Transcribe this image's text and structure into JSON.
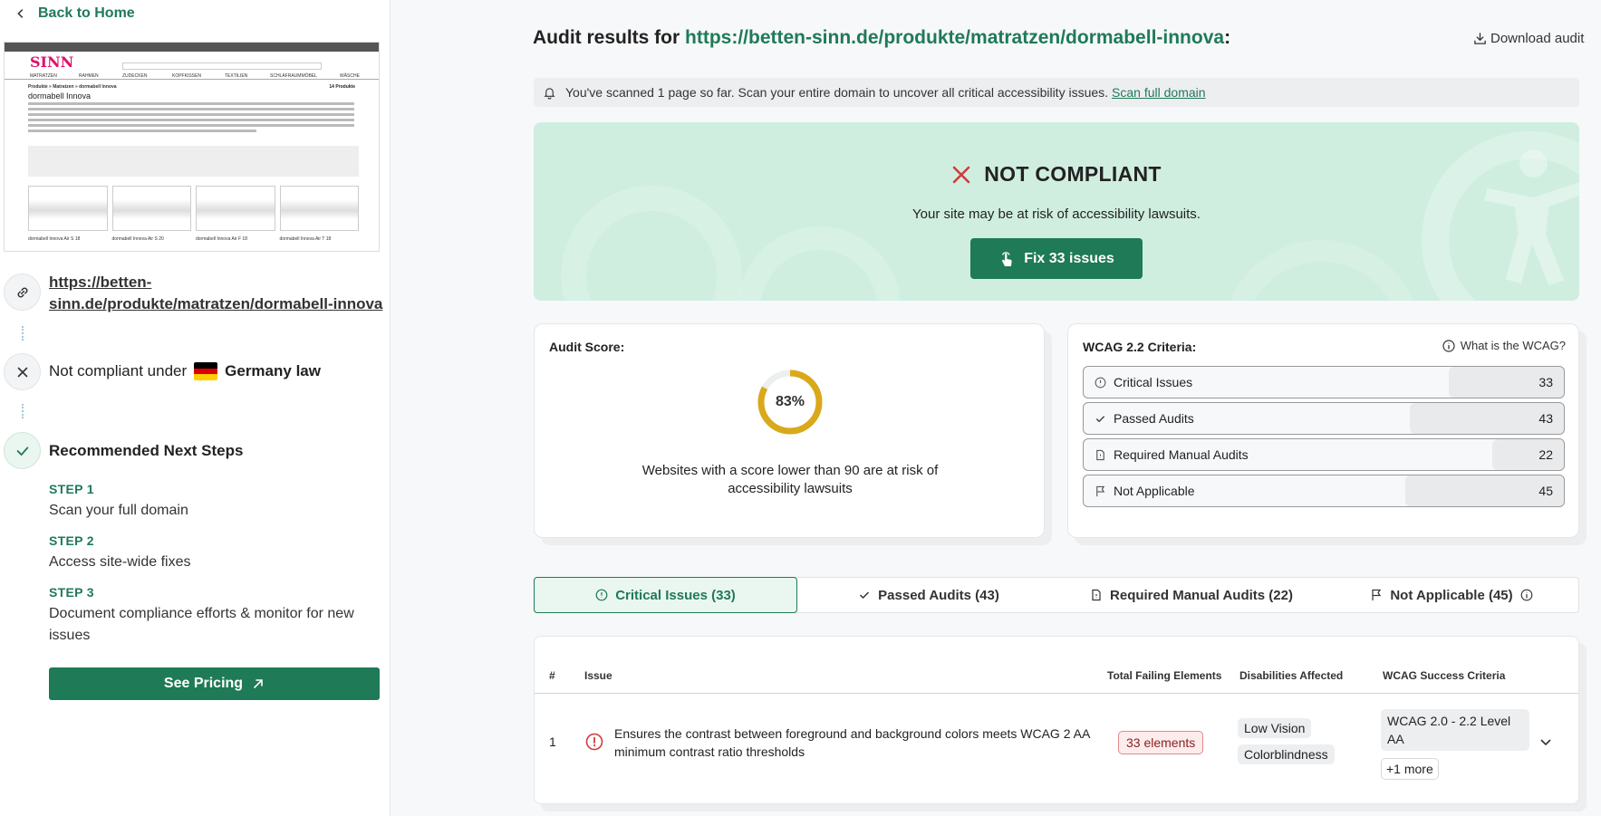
{
  "sidebar": {
    "back_label": "Back to Home",
    "preview": {
      "brand": "SINN",
      "breadcrumb": "Produkte » Matratzen » dormabell Innova",
      "count": "14 Produkte",
      "title": "dormabell Innova",
      "nav": [
        "MATRATZEN",
        "RAHMEN",
        "ZUDECKEN",
        "KOPFKISSEN",
        "TEXTILIEN",
        "SCHLAFRAUMMÖBEL",
        "WÄSCHE"
      ],
      "products": [
        "dormabell Innova Air S 18",
        "dormabell Innova Air S 20",
        "dormabell Innova Air F 18",
        "dormabell Innova Air T 18"
      ]
    },
    "url": "https://betten-sinn.de/produkte/matratzen/dormabell-innova",
    "noncompliant_prefix": "Not compliant under",
    "law": "Germany law",
    "recommended_title": "Recommended Next Steps",
    "steps": [
      {
        "label": "STEP 1",
        "text": "Scan your full domain"
      },
      {
        "label": "STEP 2",
        "text": "Access site-wide fixes"
      },
      {
        "label": "STEP 3",
        "text": "Document compliance efforts & monitor for new issues"
      }
    ],
    "pricing_label": "See Pricing"
  },
  "header": {
    "title_prefix": "Audit results for",
    "url": "https://betten-sinn.de/produkte/matratzen/dormabell-innova",
    "title_suffix": ":",
    "download_label": "Download audit"
  },
  "banner": {
    "text": "You've scanned 1 page so far. Scan your entire domain to uncover all critical accessibility issues.",
    "link": "Scan full domain"
  },
  "hero": {
    "status": "NOT COMPLIANT",
    "risk": "Your site may be at risk of accessibility lawsuits.",
    "fix_label": "Fix 33 issues"
  },
  "score": {
    "title": "Audit Score:",
    "value": 83,
    "value_label": "83%",
    "note": "Websites with a score lower than 90 are at risk of accessibility lawsuits"
  },
  "wcag": {
    "title": "WCAG 2.2 Criteria:",
    "help": "What is the WCAG?",
    "rows": [
      {
        "label": "Critical Issues",
        "value": "33",
        "icon": "alert-circle-icon"
      },
      {
        "label": "Passed Audits",
        "value": "43",
        "icon": "check-icon"
      },
      {
        "label": "Required Manual Audits",
        "value": "22",
        "icon": "document-icon"
      },
      {
        "label": "Not Applicable",
        "value": "45",
        "icon": "flag-icon"
      }
    ]
  },
  "tabs": [
    {
      "label": "Critical Issues (33)",
      "icon": "alert-circle-icon"
    },
    {
      "label": "Passed Audits (43)",
      "icon": "check-icon"
    },
    {
      "label": "Required Manual Audits (22)",
      "icon": "document-icon"
    },
    {
      "label": "Not Applicable (45)",
      "icon": "flag-icon"
    }
  ],
  "table": {
    "headers": [
      "#",
      "Issue",
      "Total Failing Elements",
      "Disabilities Affected",
      "WCAG Success Criteria"
    ],
    "rows": [
      {
        "num": "1",
        "issue": "Ensures the contrast between foreground and background colors meets WCAG 2 AA minimum contrast ratio thresholds",
        "failing": "33 elements",
        "disabilities": [
          "Low Vision",
          "Colorblindness"
        ],
        "criteria": "WCAG 2.0 - 2.2 Level AA",
        "more": "+1 more"
      }
    ]
  },
  "colors": {
    "accent": "#1f7a57",
    "hero_bg": "#cfeee0",
    "error": "#d13b3b",
    "score_ring": "#d9a91a"
  }
}
